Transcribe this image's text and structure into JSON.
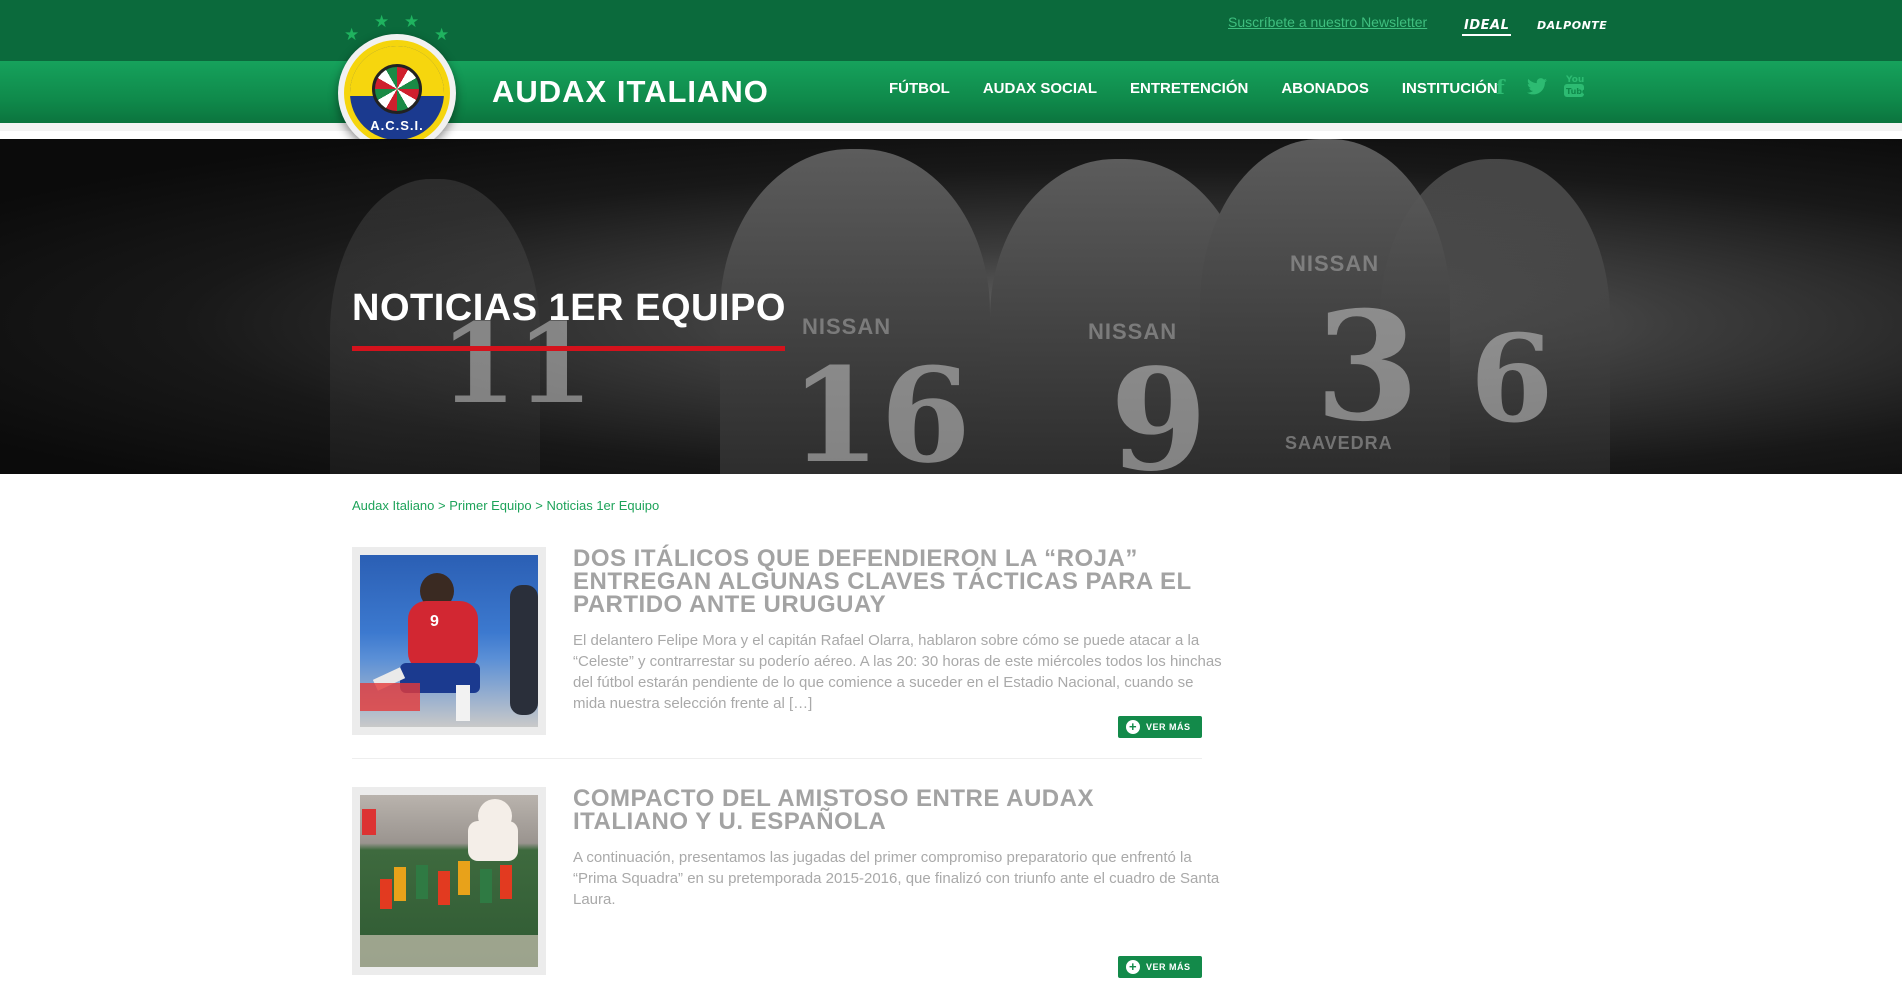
{
  "header": {
    "newsletter_link": "Suscríbete a nuestro Newsletter",
    "partners": [
      "IDEAL",
      "DALPONTE"
    ],
    "crest_text": "A.C.S.I.",
    "site_title": "AUDAX ITALIANO",
    "nav": [
      "FÚTBOL",
      "AUDAX SOCIAL",
      "ENTRETENCIÓN",
      "ABONADOS",
      "INSTITUCIÓN"
    ],
    "social": [
      "facebook-icon",
      "twitter-icon",
      "youtube-icon"
    ]
  },
  "hero": {
    "title": "NOTICIAS 1ER EQUIPO",
    "shirt_numbers": [
      "11",
      "16",
      "9",
      "3",
      "6"
    ],
    "shirt_sponsor": "NISSAN",
    "shirt_name": "SAAVEDRA"
  },
  "breadcrumb": {
    "items": [
      "Audax Italiano",
      "Primer Equipo",
      "Noticias 1er Equipo"
    ],
    "separator": ">"
  },
  "articles": [
    {
      "title": "DOS ITÁLICOS QUE DEFENDIERON LA “ROJA” ENTREGAN ALGUNAS CLAVES TÁCTICAS PARA EL PARTIDO ANTE URUGUAY",
      "excerpt": "El delantero Felipe Mora y el capitán Rafael Olarra, hablaron sobre cómo se puede atacar a la “Celeste” y contrarrestar su poderío aéreo. A las 20: 30 horas de este miércoles todos los hinchas del fútbol estarán pendiente de lo que comience a suceder en el Estadio Nacional, cuando se mida nuestra selección frente al […]",
      "button": "VER MÁS"
    },
    {
      "title": "COMPACTO DEL AMISTOSO ENTRE AUDAX ITALIANO Y U. ESPAÑOLA",
      "excerpt": "A continuación, presentamos las jugadas del primer compromiso preparatorio que enfrentó la “Prima Squadra” en su pretemporada 2015-2016, que finalizó con triunfo ante el cuadro de Santa Laura.",
      "button": "VER MÁS"
    }
  ],
  "colors": {
    "brand_green": "#0b6a3c",
    "accent_red": "#d4121c",
    "link_green": "#1ea35a"
  }
}
